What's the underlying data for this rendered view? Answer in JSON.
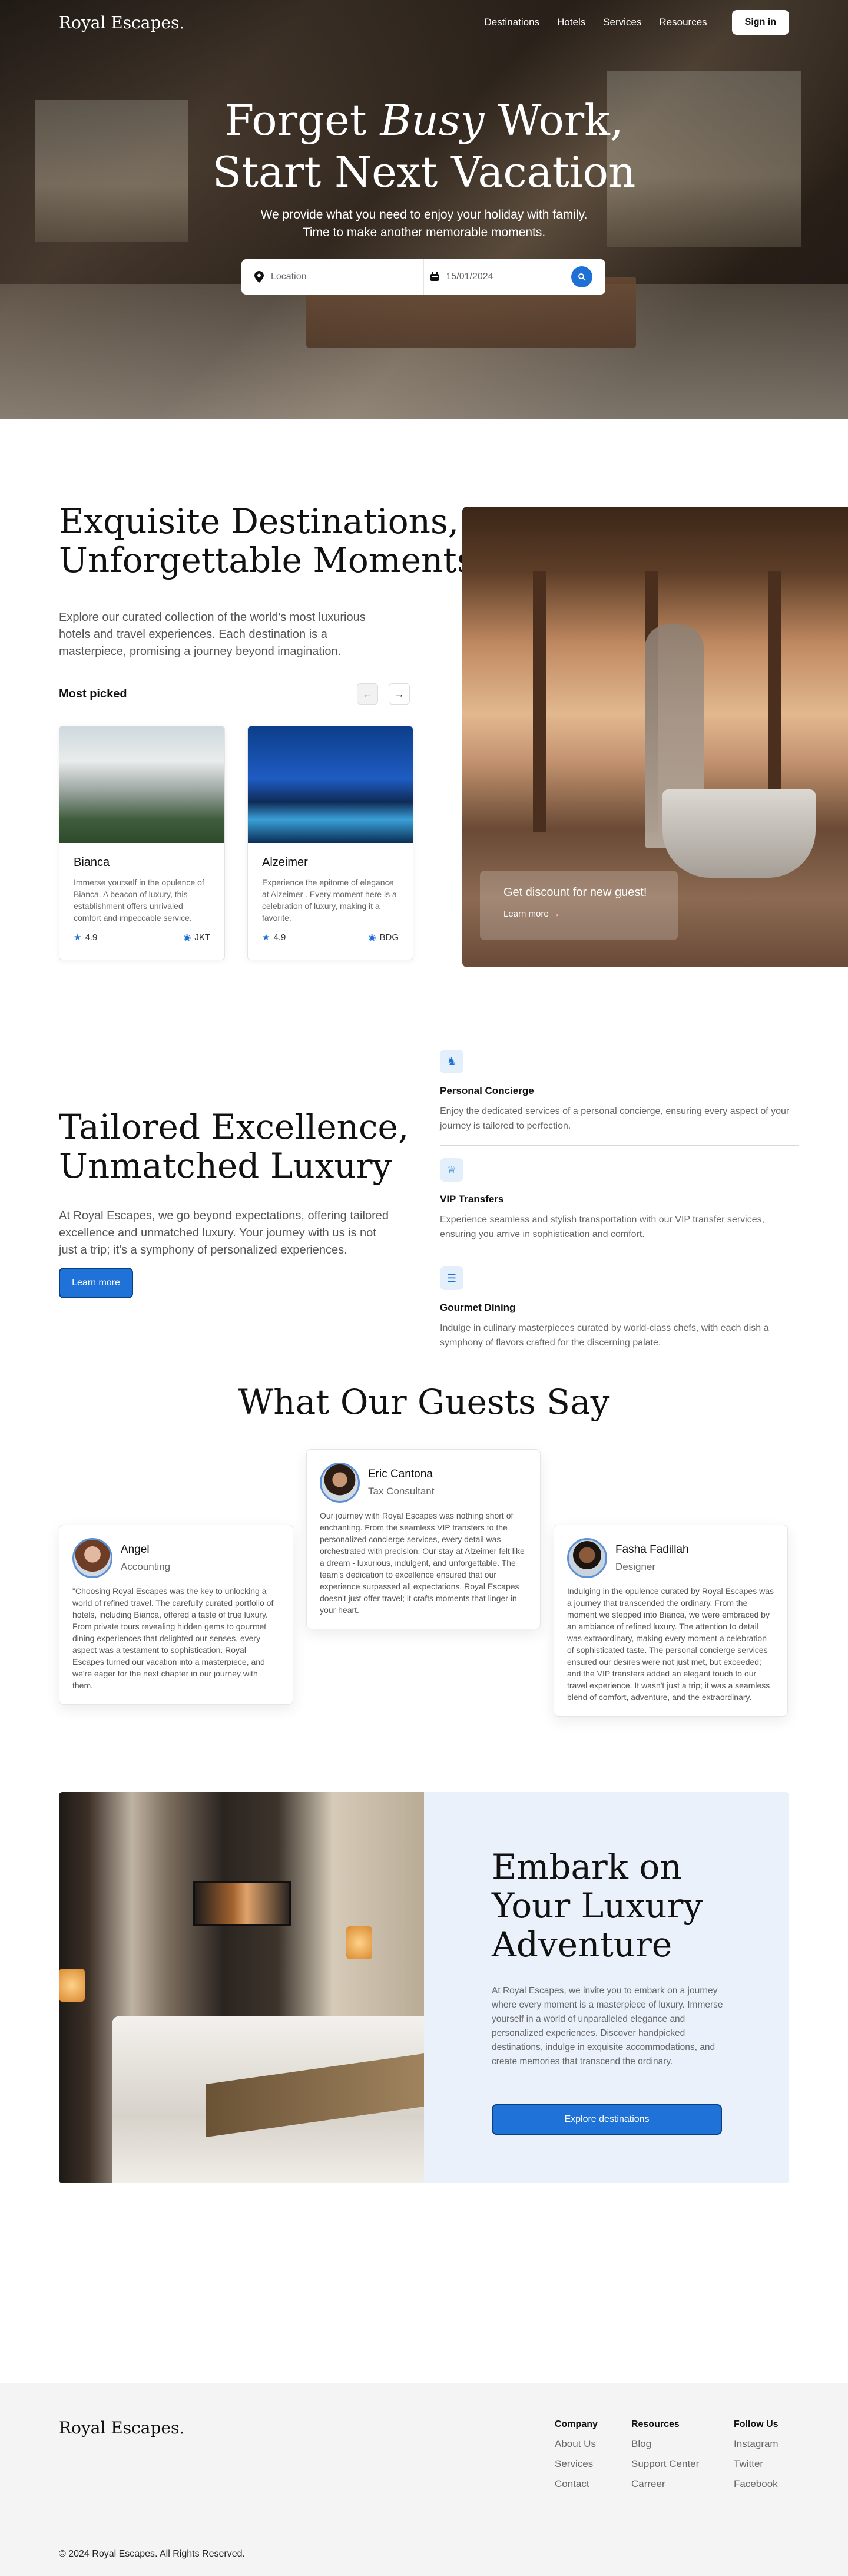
{
  "brand": "Royal Escapes.",
  "nav": {
    "links": [
      "Destinations",
      "Hotels",
      "Services",
      "Resources"
    ],
    "signin": "Sign in"
  },
  "hero": {
    "title_pre": "Forget ",
    "title_italic": "Busy",
    "title_post": " Work,",
    "title_line2": "Start Next Vacation",
    "subtitle_1": "We provide what you need to enjoy your  holiday with family.",
    "subtitle_2": "Time to make another memorable moments.",
    "location_placeholder": "Location",
    "date_value": "15/01/2024"
  },
  "destinations": {
    "title_1": "Exquisite Destinations,",
    "title_2": "Unforgettable Moments",
    "description": "Explore our curated collection of the world's most luxurious hotels and travel experiences. Each destination is a masterpiece, promising a journey beyond imagination.",
    "most_picked": "Most picked",
    "cards": [
      {
        "name": "Bianca",
        "text": "Immerse yourself in the opulence of Bianca. A beacon of luxury, this establishment offers unrivaled comfort and impeccable service.",
        "rating": "4.9",
        "code": "JKT"
      },
      {
        "name": "Alzeimer",
        "text": "Experience the epitome of elegance at Alzeimer . Every moment here is a celebration of luxury, making it a favorite.",
        "rating": "4.9",
        "code": "BDG"
      }
    ],
    "promo_title": "Get discount for new guest!",
    "promo_link": "Learn more"
  },
  "services": {
    "title_1": "Tailored Excellence,",
    "title_2": "Unmatched Luxury",
    "description": "At Royal Escapes, we go beyond expectations, offering tailored excellence and unmatched luxury. Your journey with us is not just a trip; it's a symphony of personalized experiences.",
    "button": "Learn more",
    "features": [
      {
        "icon": "concierge-icon",
        "title": "Personal Concierge",
        "text": "Enjoy the dedicated services of a personal concierge, ensuring every aspect of your journey is tailored to perfection."
      },
      {
        "icon": "crown-icon",
        "title": "VIP Transfers",
        "text": "Experience seamless and stylish transportation with our VIP transfer services, ensuring you arrive in sophistication and comfort."
      },
      {
        "icon": "dining-icon",
        "title": "Gourmet Dining",
        "text": "Indulge in culinary masterpieces curated by world-class chefs, with each dish a symphony of flavors crafted for the discerning palate."
      }
    ]
  },
  "testimonials": {
    "title": "What Our Guests Say",
    "items": [
      {
        "name": "Angel",
        "role": "Accounting",
        "text": "\"Choosing Royal Escapes was the key to unlocking a world of refined travel. The carefully curated portfolio of hotels, including Bianca, offered a taste of true luxury. From private tours revealing hidden gems to gourmet dining experiences that delighted our senses, every aspect was a testament to sophistication. Royal Escapes turned our vacation into a masterpiece, and we're eager for the next chapter in our journey with them."
      },
      {
        "name": "Eric Cantona",
        "role": "Tax Consultant",
        "text": "Our journey with Royal Escapes was nothing short of enchanting. From the seamless VIP transfers to the personalized concierge services, every detail was orchestrated with precision. Our stay at Alzeimer felt like a dream - luxurious, indulgent, and unforgettable. The team's dedication to excellence ensured that our experience surpassed all expectations. Royal Escapes doesn't just offer travel; it crafts moments that linger in your heart."
      },
      {
        "name": "Fasha Fadillah",
        "role": "Designer",
        "text": "Indulging in the opulence curated by Royal Escapes was a journey that transcended the ordinary. From the moment we stepped into Bianca, we were embraced by an ambiance of refined luxury. The attention to detail was extraordinary, making every moment a celebration of sophisticated taste. The personal concierge services ensured our desires were not just met, but exceeded; and the VIP transfers added an elegant touch to our travel experience. It wasn't just a trip; it was a seamless blend of comfort, adventure, and the extraordinary."
      }
    ]
  },
  "cta": {
    "title_1": "Embark on",
    "title_2": "Your Luxury",
    "title_3": "Adventure",
    "description": "At Royal Escapes, we invite you to embark on a journey where every moment is a masterpiece of luxury. Immerse yourself in a world of unparalleled elegance and personalized experiences. Discover handpicked destinations, indulge in exquisite accommodations, and create memories that transcend the ordinary.",
    "button": "Explore destinations"
  },
  "footer": {
    "company": {
      "heading": "Company",
      "items": [
        "About Us",
        "Services",
        "Contact"
      ]
    },
    "resources": {
      "heading": "Resources",
      "items": [
        "Blog",
        "Support Center",
        "Carreer"
      ]
    },
    "follow": {
      "heading": "Follow Us",
      "items": [
        "Instagram",
        "Twitter",
        "Facebook"
      ]
    },
    "copyright": "© 2024 Royal Escapes. All Rights Reserved."
  },
  "colors": {
    "accent": "#1e72d8",
    "footer_bg": "#f4f4f4",
    "cta_bg": "#eaf1fb"
  }
}
